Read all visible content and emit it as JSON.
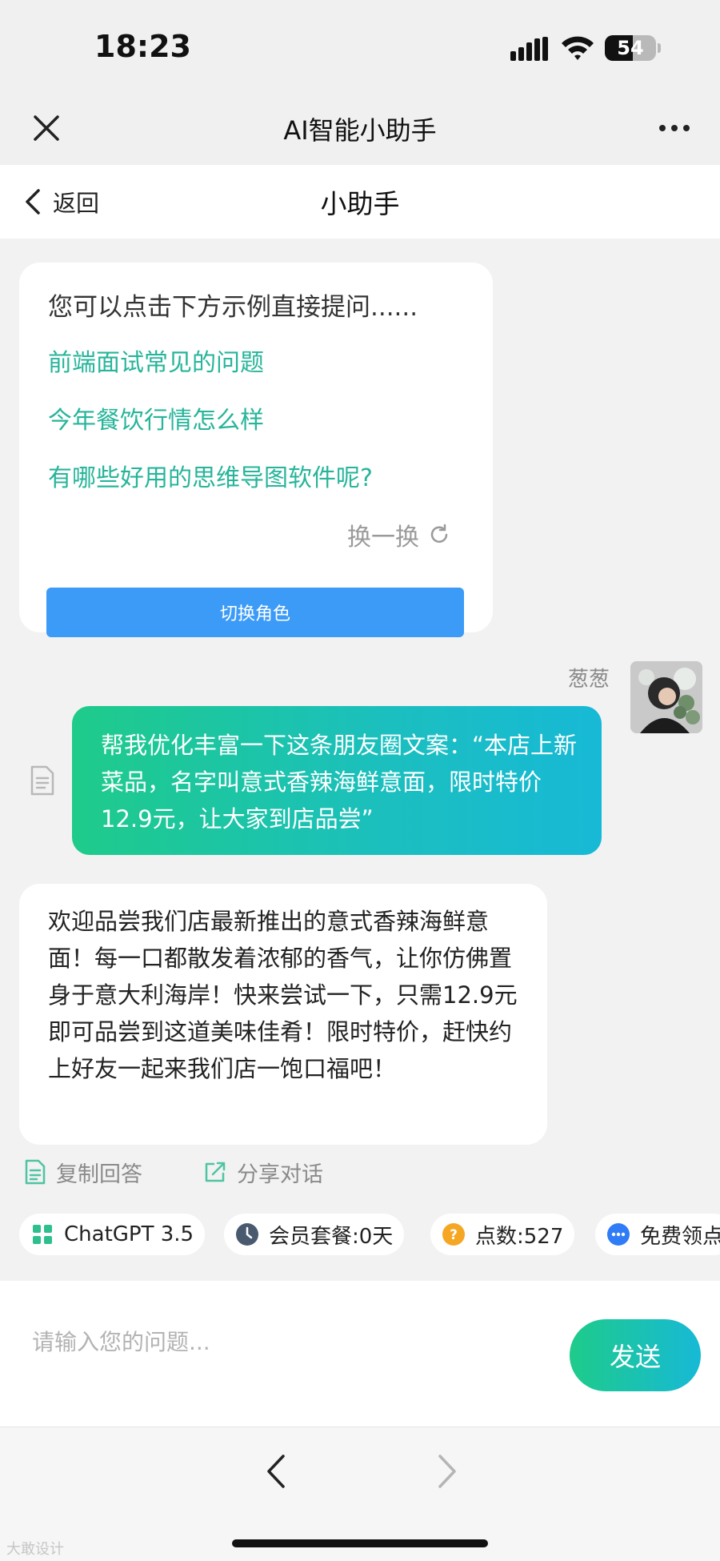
{
  "status_bar": {
    "time": "18:23",
    "battery": "54",
    "battery_level": 0.54
  },
  "app": {
    "title": "AI智能小助手"
  },
  "nav": {
    "back_label": "返回",
    "title": "小助手"
  },
  "suggestions": {
    "intro": "您可以点击下方示例直接提问......",
    "items": [
      "前端面试常见的问题",
      "今年餐饮行情怎么样",
      "有哪些好用的思维导图软件呢?"
    ],
    "refresh_label": "换一换",
    "switch_role_label": "切换角色"
  },
  "user_message": {
    "name": "葱葱",
    "text": "帮我优化丰富一下这条朋友圈文案：“本店上新菜品，名字叫意式香辣海鲜意面，限时特价12.9元，让大家到店品尝”"
  },
  "assistant_reply": {
    "text": "欢迎品尝我们店最新推出的意式香辣海鲜意面！每一口都散发着浓郁的香气，让你仿佛置身于意大利海岸！快来尝试一下，只需12.9元即可品尝到这道美味佳肴！限时特价，赶快约上好友一起来我们店一饱口福吧！"
  },
  "actions": {
    "copy_label": "复制回答",
    "share_label": "分享对话"
  },
  "chips": {
    "model": "ChatGPT 3.5",
    "membership": "会员套餐:0天",
    "points": "点数:527",
    "free_points": "免费领点"
  },
  "input": {
    "placeholder": "请输入您的问题...",
    "value": "",
    "send_label": "发送"
  },
  "watermark": "大敢设计",
  "colors": {
    "accent_green": "#27b59a",
    "gradient_start": "#1ecb8a",
    "gradient_end": "#17b9d6",
    "button_blue": "#3c9bf7"
  }
}
